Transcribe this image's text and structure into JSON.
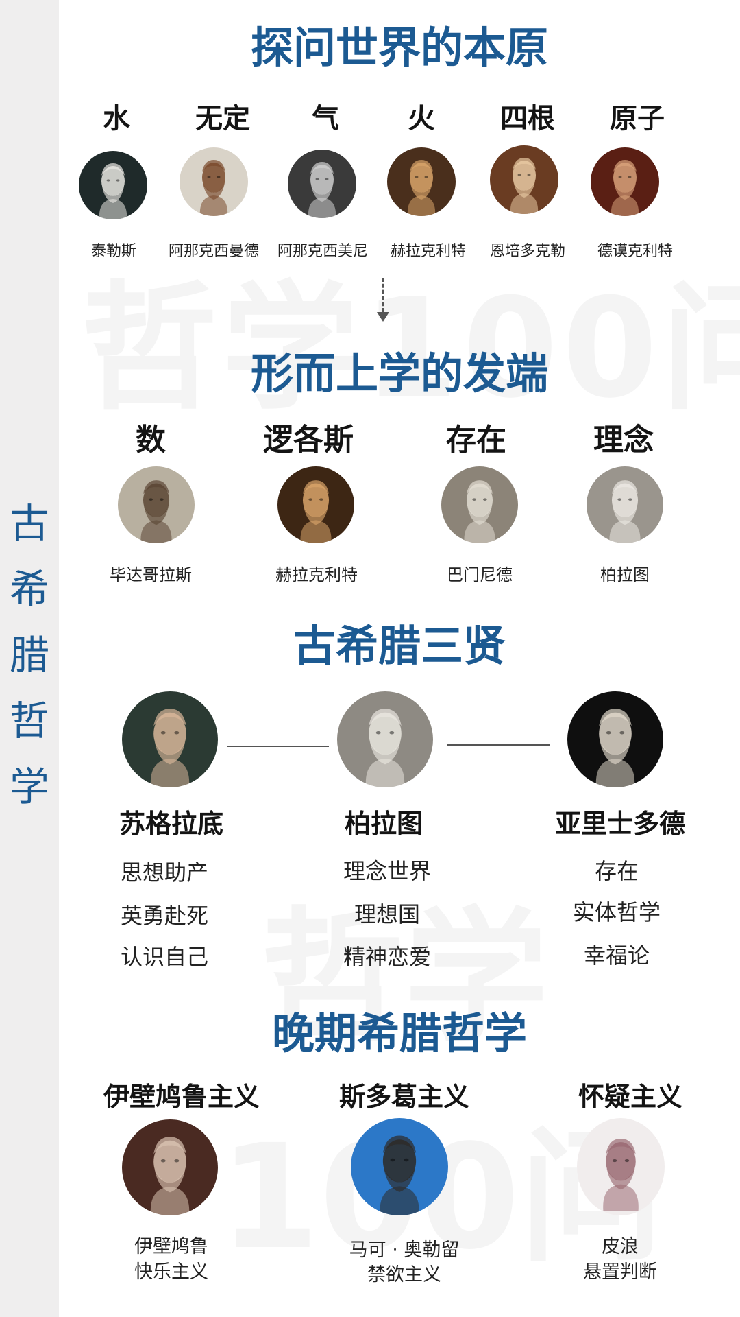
{
  "sidebar": {
    "title_chars": [
      "古",
      "希",
      "腊",
      "哲",
      "学"
    ]
  },
  "watermark": {
    "line1": "哲学100问",
    "line2": "哲学",
    "line3": "100问"
  },
  "section1": {
    "title": "探问世界的本原",
    "items": [
      {
        "concept": "水",
        "name": "泰勒斯"
      },
      {
        "concept": "无定",
        "name": "阿那克西曼德"
      },
      {
        "concept": "气",
        "name": "阿那克西美尼"
      },
      {
        "concept": "火",
        "name": "赫拉克利特"
      },
      {
        "concept": "四根",
        "name": "恩培多克勒"
      },
      {
        "concept": "原子",
        "name": "德谟克利特"
      }
    ]
  },
  "section2": {
    "title": "形而上学的发端",
    "items": [
      {
        "concept": "数",
        "name": "毕达哥拉斯"
      },
      {
        "concept": "逻各斯",
        "name": "赫拉克利特"
      },
      {
        "concept": "存在",
        "name": "巴门尼德"
      },
      {
        "concept": "理念",
        "name": "柏拉图"
      }
    ]
  },
  "section3": {
    "title": "古希腊三贤",
    "sages": [
      {
        "name": "苏格拉底",
        "traits": [
          "思想助产",
          "英勇赴死",
          "认识自己"
        ]
      },
      {
        "name": "柏拉图",
        "traits": [
          "理念世界",
          "理想国",
          "精神恋爱"
        ]
      },
      {
        "name": "亚里士多德",
        "traits": [
          "存在",
          "实体哲学",
          "幸福论"
        ]
      }
    ]
  },
  "section4": {
    "title": "晚期希腊哲学",
    "schools": [
      {
        "school": "伊壁鸠鲁主义",
        "person": "伊壁鸠鲁",
        "idea": "快乐主义"
      },
      {
        "school": "斯多葛主义",
        "person": "马可 · 奥勒留",
        "idea": "禁欲主义"
      },
      {
        "school": "怀疑主义",
        "person": "皮浪",
        "idea": "悬置判断"
      }
    ]
  },
  "colors": {
    "accent": "#1c5a92",
    "sidebar_bg": "#efeeee"
  }
}
